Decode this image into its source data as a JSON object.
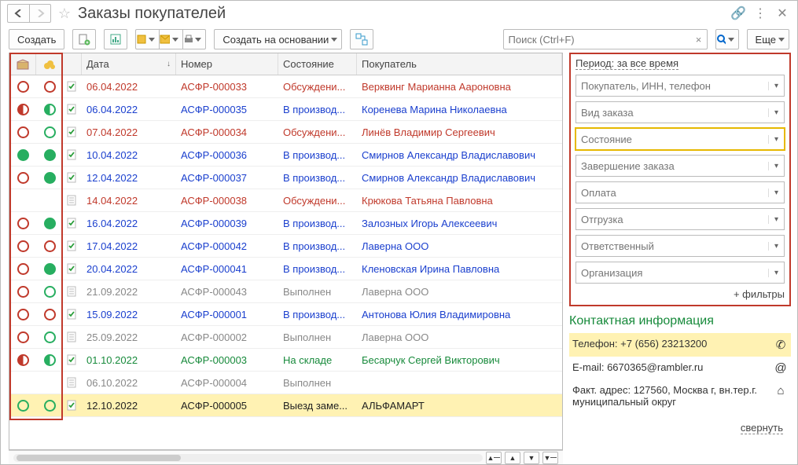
{
  "title": "Заказы покупателей",
  "toolbar": {
    "create": "Создать",
    "create_based": "Создать на основании",
    "more": "Еще",
    "search_placeholder": "Поиск (Ctrl+F)"
  },
  "columns": {
    "date": "Дата",
    "number": "Номер",
    "state": "Состояние",
    "buyer": "Покупатель"
  },
  "rows": [
    {
      "s1": "ring red",
      "s2": "ring red",
      "doc": "chk",
      "date": "06.04.2022",
      "num": "АСФР-000033",
      "state": "Обсуждени...",
      "buyer": "Верквинг Марианна Аароновна",
      "cls": "t-red"
    },
    {
      "s1": "half red",
      "s2": "half green",
      "doc": "chk",
      "date": "06.04.2022",
      "num": "АСФР-000035",
      "state": "В производ...",
      "buyer": "Коренева Марина Николаевна",
      "cls": "t-blue"
    },
    {
      "s1": "ring red",
      "s2": "ring green",
      "doc": "chk",
      "date": "07.04.2022",
      "num": "АСФР-000034",
      "state": "Обсуждени...",
      "buyer": "Линёв Владимир Сергеевич",
      "cls": "t-red"
    },
    {
      "s1": "solid green",
      "s2": "solid green",
      "doc": "chk",
      "date": "10.04.2022",
      "num": "АСФР-000036",
      "state": "В производ...",
      "buyer": "Смирнов Александр Владиславович",
      "cls": "t-blue"
    },
    {
      "s1": "ring red",
      "s2": "solid green",
      "doc": "chk",
      "date": "12.04.2022",
      "num": "АСФР-000037",
      "state": "В производ...",
      "buyer": "Смирнов Александр Владиславович",
      "cls": "t-blue"
    },
    {
      "s1": "",
      "s2": "",
      "doc": "pln",
      "date": "14.04.2022",
      "num": "АСФР-000038",
      "state": "Обсуждени...",
      "buyer": "Крюкова Татьяна Павловна",
      "cls": "t-red"
    },
    {
      "s1": "ring red",
      "s2": "solid green",
      "doc": "chk",
      "date": "16.04.2022",
      "num": "АСФР-000039",
      "state": "В производ...",
      "buyer": "Залозных Игорь Алексеевич",
      "cls": "t-blue"
    },
    {
      "s1": "ring red",
      "s2": "ring red",
      "doc": "chk",
      "date": "17.04.2022",
      "num": "АСФР-000042",
      "state": "В производ...",
      "buyer": "Лаверна ООО",
      "cls": "t-blue"
    },
    {
      "s1": "ring red",
      "s2": "solid green",
      "doc": "chk",
      "date": "20.04.2022",
      "num": "АСФР-000041",
      "state": "В производ...",
      "buyer": "Кленовская Ирина Павловна",
      "cls": "t-blue"
    },
    {
      "s1": "ring red",
      "s2": "ring green",
      "doc": "pln",
      "date": "21.09.2022",
      "num": "АСФР-000043",
      "state": "Выполнен",
      "buyer": "Лаверна ООО",
      "cls": "t-grey"
    },
    {
      "s1": "ring red",
      "s2": "ring red",
      "doc": "chk",
      "date": "15.09.2022",
      "num": "АСФР-000001",
      "state": "В производ...",
      "buyer": "Антонова Юлия Владимировна",
      "cls": "t-blue"
    },
    {
      "s1": "ring red",
      "s2": "ring green",
      "doc": "pln",
      "date": "25.09.2022",
      "num": "АСФР-000002",
      "state": "Выполнен",
      "buyer": "Лаверна ООО",
      "cls": "t-grey"
    },
    {
      "s1": "half red",
      "s2": "half green",
      "doc": "chk",
      "date": "01.10.2022",
      "num": "АСФР-000003",
      "state": "На складе",
      "buyer": "Бесарчук Сергей Викторович",
      "cls": "t-green"
    },
    {
      "s1": "",
      "s2": "",
      "doc": "pln",
      "date": "06.10.2022",
      "num": "АСФР-000004",
      "state": "Выполнен",
      "buyer": "",
      "cls": "t-grey"
    },
    {
      "s1": "ring green",
      "s2": "ring green",
      "doc": "chk",
      "date": "12.10.2022",
      "num": "АСФР-000005",
      "state": "Выезд заме...",
      "buyer": "АЛЬФАМАРТ",
      "cls": "t-black",
      "selected": true
    }
  ],
  "filters": {
    "period_label": "Период: за все время",
    "f0": "Покупатель, ИНН, телефон",
    "f1": "Вид заказа",
    "f2": "Состояние",
    "f3": "Завершение заказа",
    "f4": "Оплата",
    "f5": "Отгрузка",
    "f6": "Ответственный",
    "f7": "Организация",
    "add": "+ фильтры"
  },
  "contact": {
    "title": "Контактная информация",
    "phone_label": "Телефон: ",
    "phone": "+7 (656) 23213200",
    "email_label": "E-mail: ",
    "email": "6670365@rambler.ru",
    "addr_label": "Факт. адрес: ",
    "addr": "127560, Москва г, вн.тер.г. муниципальный округ"
  },
  "collapse": "свернуть"
}
